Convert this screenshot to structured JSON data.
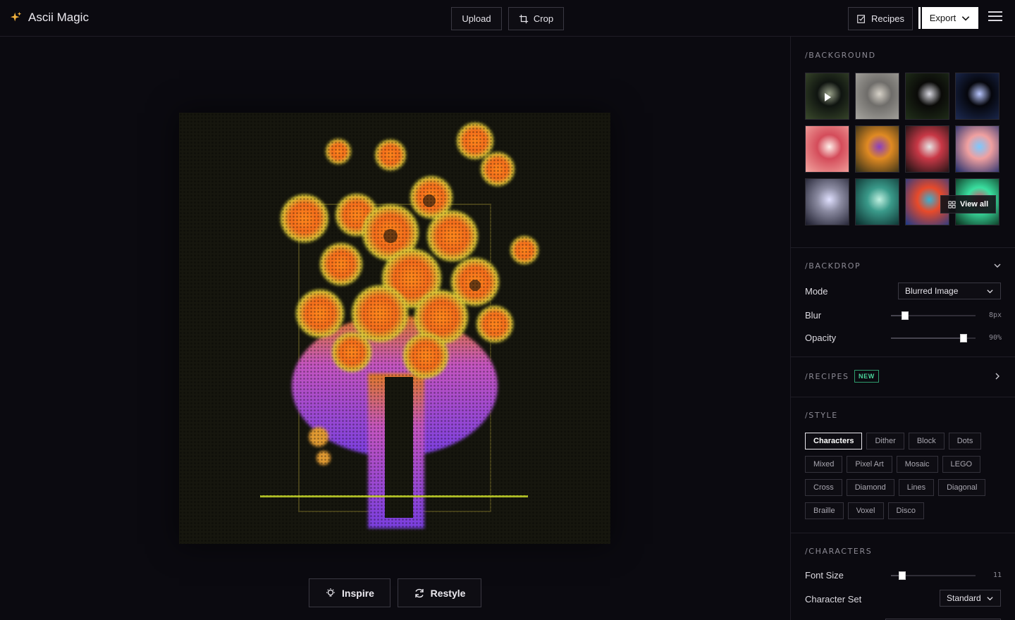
{
  "app": {
    "title": "Ascii Magic"
  },
  "toolbar": {
    "upload": "Upload",
    "crop": "Crop",
    "recipes": "Recipes",
    "export": "Export"
  },
  "canvas": {
    "inspire": "Inspire",
    "restyle": "Restyle"
  },
  "background": {
    "title": "/BACKGROUND",
    "view_all": "View all",
    "thumbs": [
      {
        "name": "thumb-desert-arch",
        "colors": [
          "#3b4a2c",
          "#0f1410",
          "#9aa28a"
        ]
      },
      {
        "name": "thumb-statue",
        "colors": [
          "#a8a6a0",
          "#6f6d6a",
          "#d7d2c8"
        ]
      },
      {
        "name": "thumb-laptop",
        "colors": [
          "#21301a",
          "#0a0a08",
          "#d8d8e0"
        ]
      },
      {
        "name": "thumb-car",
        "colors": [
          "#1c2a52",
          "#05060c",
          "#b8c6ff"
        ]
      },
      {
        "name": "thumb-flower",
        "colors": [
          "#f2a6a0",
          "#d44c5a",
          "#fff0ea"
        ]
      },
      {
        "name": "thumb-vase",
        "colors": [
          "#2a2a18",
          "#e08a22",
          "#8a3fc0"
        ]
      },
      {
        "name": "thumb-bouquet",
        "colors": [
          "#101010",
          "#c83846",
          "#e6e6e6"
        ]
      },
      {
        "name": "thumb-light-streak",
        "colors": [
          "#1b2a6a",
          "#f0a0a0",
          "#7cc8ff"
        ]
      },
      {
        "name": "thumb-hands",
        "colors": [
          "#1a1a2a",
          "#8a8aa0",
          "#e0e0ff"
        ]
      },
      {
        "name": "thumb-wave",
        "colors": [
          "#0a2a2a",
          "#3a9a8a",
          "#c0f0e0"
        ]
      },
      {
        "name": "thumb-portrait",
        "colors": [
          "#1a3a8a",
          "#e84a2a",
          "#3ab0d0"
        ]
      },
      {
        "name": "thumb-mask",
        "colors": [
          "#0a2a1a",
          "#3ae0a0",
          "#e04a6a"
        ]
      }
    ]
  },
  "backdrop": {
    "title": "/BACKDROP",
    "mode_label": "Mode",
    "mode_value": "Blurred Image",
    "blur_label": "Blur",
    "blur_value": "8px",
    "blur_level": 0.17,
    "opacity_label": "Opacity",
    "opacity_value": "90%",
    "opacity_level": 0.86
  },
  "recipes": {
    "title": "/RECIPES",
    "badge": "NEW"
  },
  "style": {
    "title": "/STYLE",
    "selected": "Characters",
    "rows": [
      [
        "Characters",
        "Dither",
        "Block",
        "Dots"
      ],
      [
        "Mixed",
        "Pixel Art",
        "Mosaic",
        "LEGO"
      ],
      [
        "Cross",
        "Diamond",
        "Lines",
        "Diagonal"
      ],
      [
        "Braille",
        "Voxel",
        "Disco"
      ]
    ]
  },
  "characters": {
    "title": "/CHARACTERS",
    "font_size_label": "Font Size",
    "font_size_value": "11",
    "font_size_level": 0.13,
    "charset_label": "Character Set",
    "charset_value": "Standard"
  },
  "colors": {
    "accent": "#ffffff",
    "panel_bg": "#0b0a10",
    "badge": "#4ad49a"
  }
}
